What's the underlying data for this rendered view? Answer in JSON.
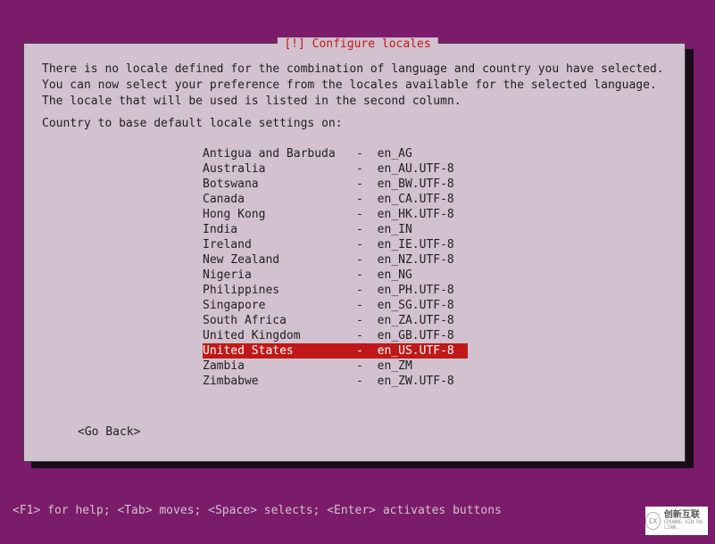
{
  "dialog": {
    "title": "[!] Configure locales",
    "intro_line1": "There is no locale defined for the combination of language and country you have selected.",
    "intro_line2": "You can now select your preference from the locales available for the selected language.",
    "intro_line3": "The locale that will be used is listed in the second column.",
    "prompt": "Country to base default locale settings on:",
    "go_back": "<Go Back>"
  },
  "locales": [
    {
      "country": "Antigua and Barbuda",
      "code": "en_AG",
      "selected": false
    },
    {
      "country": "Australia",
      "code": "en_AU.UTF-8",
      "selected": false
    },
    {
      "country": "Botswana",
      "code": "en_BW.UTF-8",
      "selected": false
    },
    {
      "country": "Canada",
      "code": "en_CA.UTF-8",
      "selected": false
    },
    {
      "country": "Hong Kong",
      "code": "en_HK.UTF-8",
      "selected": false
    },
    {
      "country": "India",
      "code": "en_IN",
      "selected": false
    },
    {
      "country": "Ireland",
      "code": "en_IE.UTF-8",
      "selected": false
    },
    {
      "country": "New Zealand",
      "code": "en_NZ.UTF-8",
      "selected": false
    },
    {
      "country": "Nigeria",
      "code": "en_NG",
      "selected": false
    },
    {
      "country": "Philippines",
      "code": "en_PH.UTF-8",
      "selected": false
    },
    {
      "country": "Singapore",
      "code": "en_SG.UTF-8",
      "selected": false
    },
    {
      "country": "South Africa",
      "code": "en_ZA.UTF-8",
      "selected": false
    },
    {
      "country": "United Kingdom",
      "code": "en_GB.UTF-8",
      "selected": false
    },
    {
      "country": "United States",
      "code": "en_US.UTF-8",
      "selected": true
    },
    {
      "country": "Zambia",
      "code": "en_ZM",
      "selected": false
    },
    {
      "country": "Zimbabwe",
      "code": "en_ZW.UTF-8",
      "selected": false
    }
  ],
  "help_bar": "<F1> for help; <Tab> moves; <Space> selects; <Enter> activates buttons",
  "watermark": {
    "top": "创新互联",
    "bottom": "CHUANG XIN HU LIAN"
  }
}
